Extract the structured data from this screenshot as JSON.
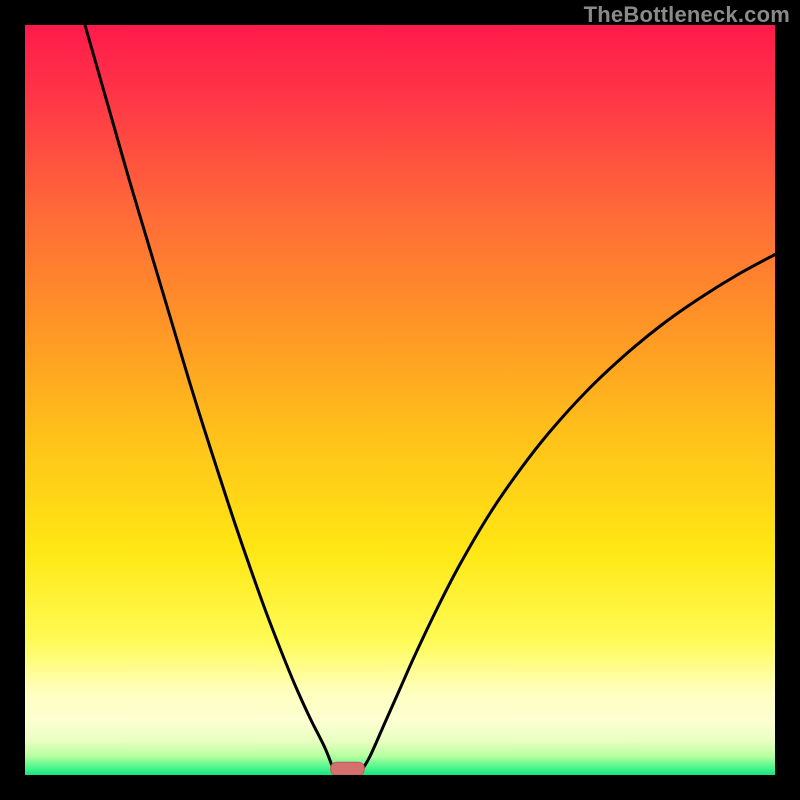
{
  "watermark": "TheBottleneck.com",
  "colors": {
    "frame": "#000000",
    "curve": "#000000",
    "marker_fill": "#d6706e",
    "marker_stroke": "#b95a5a",
    "gradient_stops": [
      {
        "offset": 0,
        "color": "#ff1a4b"
      },
      {
        "offset": 0.1,
        "color": "#ff3747"
      },
      {
        "offset": 0.25,
        "color": "#ff6a38"
      },
      {
        "offset": 0.4,
        "color": "#ff9526"
      },
      {
        "offset": 0.55,
        "color": "#ffc21a"
      },
      {
        "offset": 0.7,
        "color": "#ffe714"
      },
      {
        "offset": 0.82,
        "color": "#fffb55"
      },
      {
        "offset": 0.89,
        "color": "#ffffbf"
      },
      {
        "offset": 0.93,
        "color": "#fbffd2"
      },
      {
        "offset": 0.955,
        "color": "#e9ffc0"
      },
      {
        "offset": 0.975,
        "color": "#b6ff9f"
      },
      {
        "offset": 0.991,
        "color": "#47f58d"
      },
      {
        "offset": 1.0,
        "color": "#16e27f"
      }
    ]
  },
  "chart_data": {
    "type": "line",
    "title": "",
    "xlabel": "",
    "ylabel": "",
    "xlim": [
      0,
      100
    ],
    "ylim": [
      0,
      100
    ],
    "grid": false,
    "legend": false,
    "series": [
      {
        "name": "left-curve",
        "x": [
          8,
          10,
          12,
          14,
          16,
          18,
          20,
          22,
          24,
          26,
          28,
          30,
          32,
          34,
          36,
          38,
          40,
          41.2
        ],
        "y": [
          100,
          93,
          86,
          79,
          72.3,
          65.6,
          58.9,
          52.2,
          45.8,
          39.6,
          33.5,
          27.7,
          22.1,
          16.9,
          12.0,
          7.6,
          3.6,
          0.5
        ]
      },
      {
        "name": "right-curve",
        "x": [
          44.8,
          46,
          48,
          50,
          52,
          55,
          58,
          62,
          66,
          70,
          75,
          80,
          85,
          90,
          95,
          100
        ],
        "y": [
          0.5,
          2.5,
          7.0,
          11.5,
          16.0,
          22.3,
          28.1,
          34.9,
          40.7,
          45.8,
          51.3,
          56.0,
          60.1,
          63.6,
          66.7,
          69.4
        ]
      }
    ],
    "marker": {
      "name": "bottleneck-marker",
      "x_center": 43.0,
      "width": 4.5,
      "y": 0.5
    }
  }
}
